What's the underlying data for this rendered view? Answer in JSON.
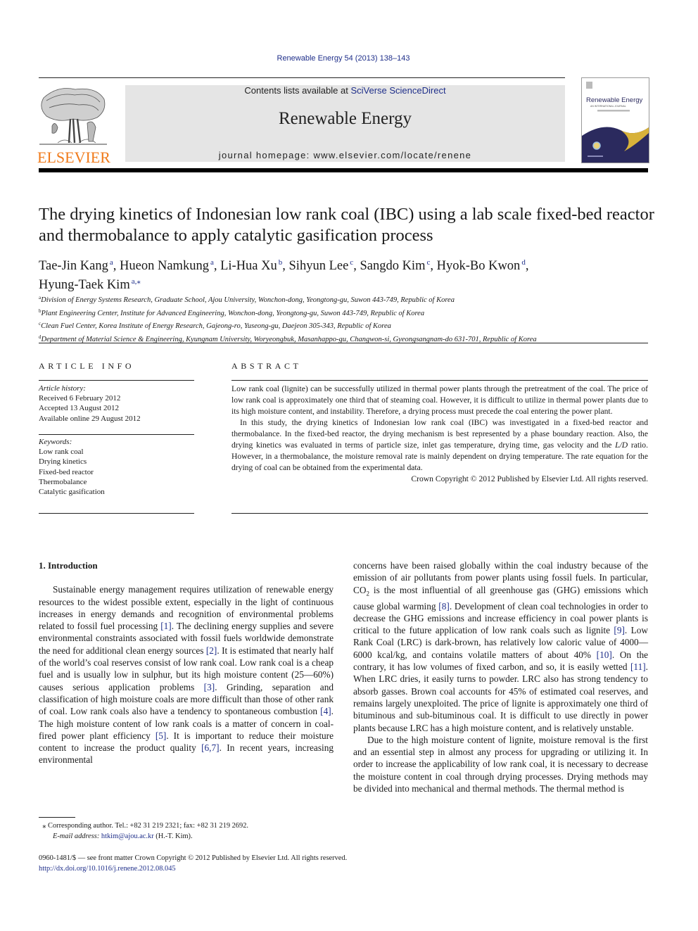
{
  "header": {
    "journal_ref": "Renewable Energy 54 (2013) 138–143",
    "contents_prefix": "Contents lists available at ",
    "contents_link": "SciVerse ScienceDirect",
    "journal_title": "Renewable Energy",
    "homepage": "journal homepage: www.elsevier.com/locate/renene",
    "publisher_logo_text": "ELSEVIER",
    "cover": {
      "title": "Renewable Energy",
      "subtitle": "AN INTERNATIONAL JOURNAL"
    }
  },
  "colors": {
    "link": "#1f2f8a",
    "elsevier_orange": "#f07a1a",
    "banner_bg": "#e5e5e5",
    "cover_navy": "#2b2a5e",
    "cover_gold": "#d8b23a"
  },
  "article": {
    "title": "The drying kinetics of Indonesian low rank coal (IBC) using a lab scale fixed-bed reactor and thermobalance to apply catalytic gasification process",
    "authors": [
      {
        "name": "Tae-Jin Kang",
        "aff": "a",
        "sep": ", "
      },
      {
        "name": "Hueon Namkung",
        "aff": "a",
        "sep": ", "
      },
      {
        "name": "Li-Hua Xu",
        "aff": "b",
        "sep": ", "
      },
      {
        "name": "Sihyun Lee",
        "aff": "c",
        "sep": ", "
      },
      {
        "name": "Sangdo Kim",
        "aff": "c",
        "sep": ", "
      },
      {
        "name": "Hyok-Bo Kwon",
        "aff": "d",
        "sep": ","
      },
      {
        "name": "Hyung-Taek Kim",
        "aff": "a,⁎",
        "sep": ""
      }
    ],
    "affiliations": [
      {
        "key": "a",
        "text": "Division of Energy Systems Research, Graduate School, Ajou University, Wonchon-dong, Yeongtong-gu, Suwon 443-749, Republic of Korea"
      },
      {
        "key": "b",
        "text": "Plant Engineering Center, Institute for Advanced Engineering, Wonchon-dong, Yeongtong-gu, Suwon 443-749, Republic of Korea"
      },
      {
        "key": "c",
        "text": "Clean Fuel Center, Korea Institute of Energy Research, Gajeong-ro, Yuseong-gu, Daejeon 305-343, Republic of Korea"
      },
      {
        "key": "d",
        "text": "Department of Material Science & Engineering, Kyungnam University, Woryeongbuk, Masanhappo-gu, Changwon-si, Gyeongsangnam-do 631-701, Republic of Korea"
      }
    ]
  },
  "article_info": {
    "heading": "ARTICLE INFO",
    "history_label": "Article history:",
    "history": [
      "Received 6 February 2012",
      "Accepted 13 August 2012",
      "Available online 29 August 2012"
    ],
    "keywords_label": "Keywords:",
    "keywords": [
      "Low rank coal",
      "Drying kinetics",
      "Fixed-bed reactor",
      "Thermobalance",
      "Catalytic gasification"
    ]
  },
  "abstract": {
    "heading": "ABSTRACT",
    "p1": "Low rank coal (lignite) can be successfully utilized in thermal power plants through the pretreatment of the coal. The price of low rank coal is approximately one third that of steaming coal. However, it is difficult to utilize in thermal power plants due to its high moisture content, and instability. Therefore, a drying process must precede the coal entering the power plant.",
    "p2_before": "In this study, the drying kinetics of Indonesian low rank coal (IBC) was investigated in a fixed-bed reactor and thermobalance. In the fixed-bed reactor, the drying mechanism is best represented by a phase boundary reaction. Also, the drying kinetics was evaluated in terms of particle size, inlet gas temperature, drying time, gas velocity and the ",
    "p2_italic": "L/D",
    "p2_after": " ratio. However, in a thermobalance, the moisture removal rate is mainly dependent on drying temperature. The rate equation for the drying of coal can be obtained from the experimental data.",
    "copyright": "Crown Copyright © 2012 Published by Elsevier Ltd. All rights reserved."
  },
  "body": {
    "section_heading": "1.  Introduction",
    "left": [
      {
        "t": "Sustainable energy management requires utilization of renewable energy resources to the widest possible extent, especially in the light of continuous increases in energy demands and recognition of environmental problems related to fossil fuel processing "
      },
      {
        "ref": "[1]"
      },
      {
        "t": ". The declining energy supplies and severe environmental constraints associated with fossil fuels worldwide demonstrate the need for additional clean energy sources "
      },
      {
        "ref": "[2]"
      },
      {
        "t": ". It is estimated that nearly half of the world’s coal reserves consist of low rank coal. Low rank coal is a cheap fuel and is usually low in sulphur, but its high moisture content (25—60%) causes serious application problems "
      },
      {
        "ref": "[3]"
      },
      {
        "t": ". Grinding, separation and classification of high moisture coals are more difficult than those of other rank of coal. Low rank coals also have a tendency to spontaneous combustion "
      },
      {
        "ref": "[4]"
      },
      {
        "t": ". The high moisture content of low rank coals is a matter of concern in coal-fired power plant efficiency "
      },
      {
        "ref": "[5]"
      },
      {
        "t": ". It is important to reduce their moisture content to increase the product quality "
      },
      {
        "ref": "[6,7]"
      },
      {
        "t": ". In recent years, increasing environmental"
      }
    ],
    "right_p1": [
      {
        "t": "concerns have been raised globally within the coal industry because of the emission of air pollutants from power plants using fossil fuels. In particular, CO"
      },
      {
        "sub": "2"
      },
      {
        "t": " is the most influential of all greenhouse gas (GHG) emissions which cause global warming "
      },
      {
        "ref": "[8]"
      },
      {
        "t": ". Development of clean coal technologies in order to decrease the GHG emissions and increase efficiency in coal power plants is critical to the future application of low rank coals such as lignite "
      },
      {
        "ref": "[9]"
      },
      {
        "t": ". Low Rank Coal (LRC) is dark-brown, has relatively low caloric value of 4000—6000 kcal/kg, and contains volatile matters of about 40% "
      },
      {
        "ref": "[10]"
      },
      {
        "t": ". On the contrary, it has low volumes of fixed carbon, and so, it is easily wetted "
      },
      {
        "ref": "[11]"
      },
      {
        "t": ". When LRC dries, it easily turns to powder. LRC also has strong tendency to absorb gasses. Brown coal accounts for 45% of estimated coal reserves, and remains largely unexploited. The price of lignite is approximately one third of bituminous and sub-bituminous coal. It is difficult to use directly in power plants because LRC has a high moisture content, and is relatively unstable."
      }
    ],
    "right_p2": "Due to the high moisture content of lignite, moisture removal is the first and an essential step in almost any process for upgrading or utilizing it. In order to increase the applicability of low rank coal, it is necessary to decrease the moisture content in coal through drying processes. Drying methods may be divided into mechanical and thermal methods. The thermal method is"
  },
  "footnote": {
    "marker": "⁎",
    "corresponding": "Corresponding author. Tel.: +82 31 219 2321; fax: +82 31 219 2692.",
    "email_label": "E-mail address:",
    "email": "htkim@ajou.ac.kr",
    "email_suffix": " (H.-T. Kim)."
  },
  "front_matter": {
    "issn_line": "0960-1481/$ — see front matter Crown Copyright © 2012 Published by Elsevier Ltd. All rights reserved.",
    "doi": "http://dx.doi.org/10.1016/j.renene.2012.08.045"
  }
}
